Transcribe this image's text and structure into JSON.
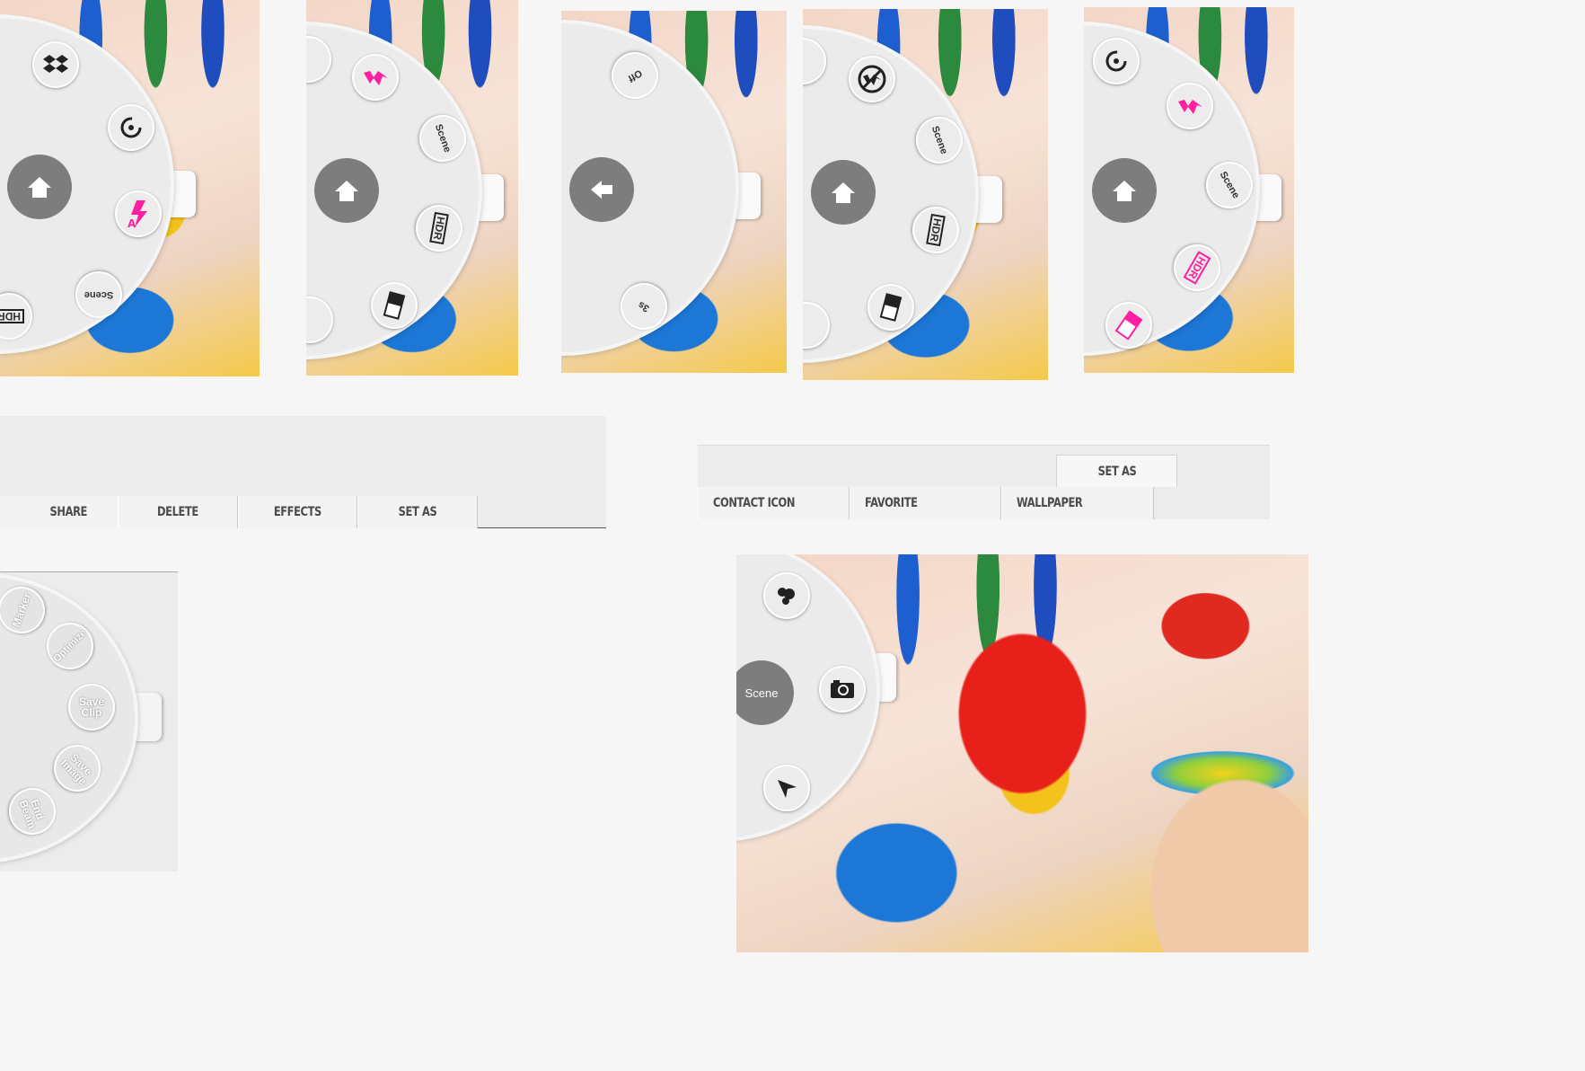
{
  "colors": {
    "accent": "#ff1fa0",
    "wheel": "#ebebeb",
    "hub": "#7d7d7d",
    "toolbar_bg": "#ececec"
  },
  "panel1": {
    "hdr": "HDR",
    "scene": "Scene",
    "icons": [
      "dropbox-icon",
      "timer-icon",
      "flash-auto-icon",
      "scene-button",
      "hdr-icon",
      "home-icon"
    ]
  },
  "panel2": {
    "scene": "Scene",
    "hdr": "HDR",
    "icons": [
      "flash-on-icon",
      "scene-button",
      "hdr-icon",
      "exposure-icon",
      "home-icon"
    ]
  },
  "panel3": {
    "off": "Off",
    "timer": "3s",
    "icons": [
      "timer-off-button",
      "timer-3s-button",
      "back-icon"
    ]
  },
  "panel4": {
    "scene": "Scene",
    "hdr": "HDR",
    "icons": [
      "flash-off-icon",
      "scene-button",
      "hdr-icon",
      "exposure-icon",
      "home-icon"
    ]
  },
  "panel5": {
    "scene": "Scene",
    "hdr": "HDR",
    "icons": [
      "timer-icon",
      "flash-on-icon",
      "scene-button",
      "hdr-icon",
      "exposure-icon",
      "home-icon"
    ]
  },
  "toolbar1": {
    "items": [
      "SHARE",
      "DELETE",
      "EFFECTS",
      "SET AS"
    ]
  },
  "toolbar2": {
    "top_item": "SET AS",
    "items": [
      "CONTACT ICON",
      "FAVORITE",
      "WALLPAPER"
    ]
  },
  "panel6": {
    "items": [
      "Marker",
      "Optimize",
      "Save Clip",
      "Save Image",
      "End Beam"
    ]
  },
  "panel7": {
    "hub": "Scene",
    "icons": [
      "beam-icon",
      "camera-icon",
      "navigate-icon"
    ]
  }
}
